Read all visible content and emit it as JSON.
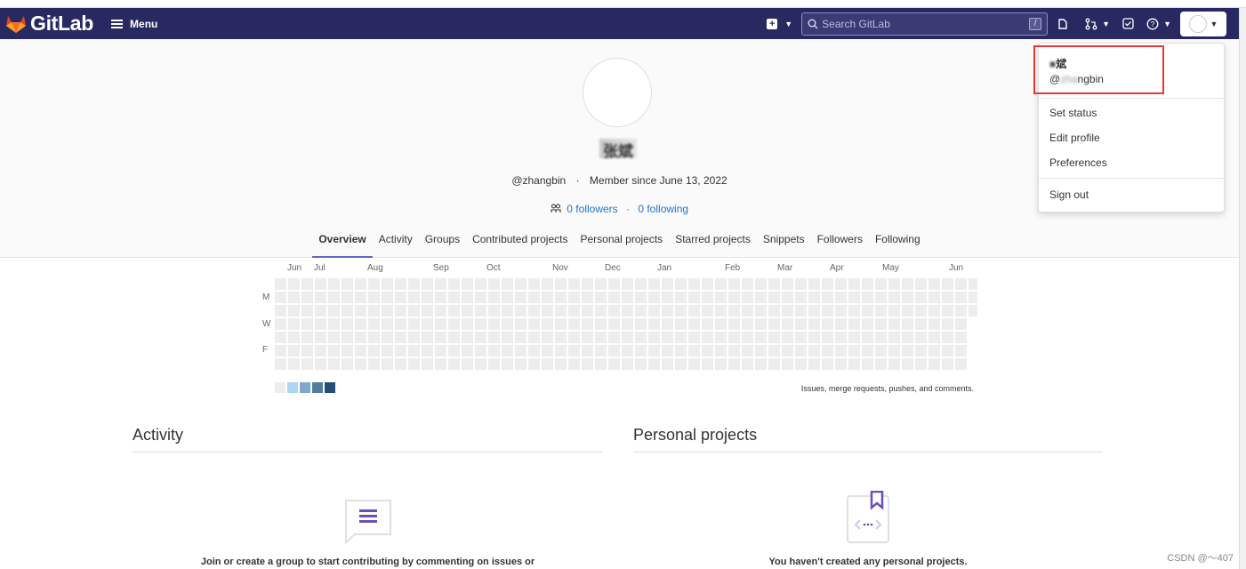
{
  "navbar": {
    "logo_text": "GitLab",
    "menu_label": "Menu",
    "search_placeholder": "Search GitLab",
    "search_shortcut": "/",
    "colors": {
      "navbar_bg": "#292961",
      "accent": "#6666c4",
      "link": "#1f75cb"
    }
  },
  "profile": {
    "display_name": "张斌",
    "handle": "@zhangbin",
    "member_since": "Member since June 13, 2022",
    "followers": "0 followers",
    "following": "0 following",
    "separator": "·"
  },
  "tabs": [
    "Overview",
    "Activity",
    "Groups",
    "Contributed projects",
    "Personal projects",
    "Starred projects",
    "Snippets",
    "Followers",
    "Following"
  ],
  "calendar": {
    "months": [
      "Jun",
      "Jul",
      "Aug",
      "Sep",
      "Oct",
      "Nov",
      "Dec",
      "Jan",
      "Feb",
      "Mar",
      "Apr",
      "May",
      "Jun"
    ],
    "day_labels": [
      "M",
      "W",
      "F"
    ],
    "caption": "Issues, merge requests, pushes, and comments.",
    "legend_colors": [
      "#ededed",
      "#acd5f2",
      "#7fa8c9",
      "#527ba0",
      "#254e77"
    ]
  },
  "sections": {
    "activity_title": "Activity",
    "projects_title": "Personal projects",
    "activity_empty": "Join or create a group to start contributing by commenting on issues or",
    "projects_empty": "You haven't created any personal projects."
  },
  "dropdown": {
    "user_name_visible": "斌",
    "user_handle_prefix": "@",
    "user_handle_blur": "zha",
    "user_handle_suffix": "ngbin",
    "items": [
      "Set status",
      "Edit profile",
      "Preferences"
    ],
    "sign_out": "Sign out"
  },
  "watermark": "CSDN @～407"
}
